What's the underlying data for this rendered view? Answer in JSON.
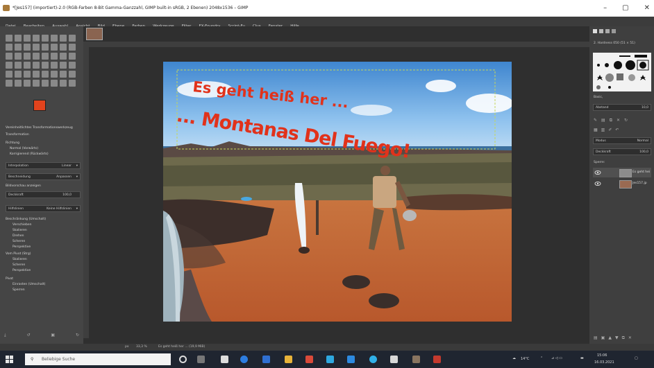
{
  "window": {
    "title": "*[Jes157] (importiert)-2.0 (RGB-Farben 8-Bit Gamma-Ganzzahl, GIMP built-in sRGB, 2 Ebenen) 2048x1536 – GIMP",
    "minimize": "–",
    "maximize": "▢",
    "close": "✕"
  },
  "menu": [
    "Datei",
    "Bearbeiten",
    "Auswahl",
    "Ansicht",
    "Bild",
    "Ebene",
    "Farben",
    "Werkzeuge",
    "Filter",
    "FX-Foundry",
    "Script-Fu",
    "Clus",
    "Fenster",
    "Hilfe"
  ],
  "tool_options": {
    "header": "Vereinheitlichtes Transformationswerkzeug",
    "transform_label": "Transformation",
    "direction_label": "Richtung",
    "direction_normal": "Normal (Vorwärts)",
    "direction_corrective": "Korrigierend (Rückwärts)",
    "interpolation_label": "Interpolation",
    "interpolation_value": "Linear",
    "clipping_label": "Beschneidung",
    "clipping_value": "Anpassen",
    "show_preview": "Bildvorschau anzeigen",
    "opacity_label": "Deckkraft",
    "opacity_value": "100,0",
    "guides_label": "Hilfslinien",
    "guides_value": "Keine Hilfslinien",
    "constrain_label": "Beschränkung (Umschalt)",
    "constrain_items": [
      "Verschieben",
      "Skalieren",
      "Drehen",
      "Scheren",
      "Perspektive"
    ],
    "pivot_label": "Vom Pivot (Strg)",
    "pivot_items": [
      "Skalieren",
      "Scheren",
      "Perspektive"
    ],
    "pivot2_label": "Pivot",
    "pivot2_items": [
      "Einrasten (Umschalt)",
      "Sperren"
    ]
  },
  "canvas": {
    "text_line1": "Es geht heiß her ...",
    "text_line2": "... Montanas Del Fuego!"
  },
  "statusbar": {
    "units": "px",
    "zoom": "33,3 %",
    "layer_info": "Es geht heiß her ... (19,9 MiB)"
  },
  "right_panel": {
    "brush_name": "2. Hardness 050 (51 × 51)",
    "brush_category": "Basic,",
    "spacing_label": "Abstand",
    "spacing_value": "10,0",
    "mode_label": "Modus",
    "mode_value": "Normal",
    "opacity_label": "Deckkraft",
    "opacity_value": "100,0",
    "lock_label": "Sperre:",
    "layers": [
      {
        "name": "Es geht hei",
        "thumb_color": "#8c8c8c"
      },
      {
        "name": "Jes157.jp",
        "thumb_color": "#9a6a52"
      }
    ]
  },
  "taskbar": {
    "search_placeholder": "Beliebige Suche",
    "temperature": "14°C",
    "time": "15:06",
    "date": "16.03.2021"
  },
  "colors": {
    "foreground": "#e2431d",
    "background": "#ffffff",
    "headline_red": "#e1321b"
  }
}
